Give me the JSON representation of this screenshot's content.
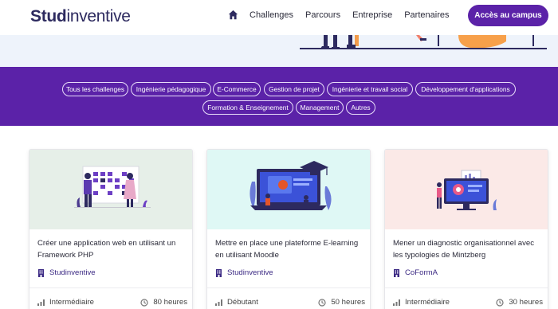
{
  "header": {
    "logo_bold": "Stud",
    "logo_light": "inventive",
    "nav": [
      "Challenges",
      "Parcours",
      "Entreprise",
      "Partenaires"
    ],
    "cta": "Accès au campus"
  },
  "filters": [
    "Tous les challenges",
    "Ingénierie pédagogique",
    "E-Commerce",
    "Gestion de projet",
    "Ingénierie et travail social",
    "Développement d'applications",
    "Formation & Enseignement",
    "Management",
    "Autres"
  ],
  "cards": [
    {
      "title": "Créer une application web en utilisant un Framework PHP",
      "org": "Studinventive",
      "level": "Intermédiaire",
      "duration": "80 heures",
      "bg": "#e6efe8"
    },
    {
      "title": "Mettre en place une plateforme E-learning en utilisant Moodle",
      "org": "Studinventive",
      "level": "Débutant",
      "duration": "50 heures",
      "bg": "#dff8f5"
    },
    {
      "title": "Mener un diagnostic organisationnel avec les typologies de Mintzberg",
      "org": "CoFormA",
      "level": "Intermédiaire",
      "duration": "30 heures",
      "bg": "#fbe9e7"
    }
  ],
  "colors": {
    "brand": "#5b22a8",
    "navy": "#2d2a5f"
  }
}
